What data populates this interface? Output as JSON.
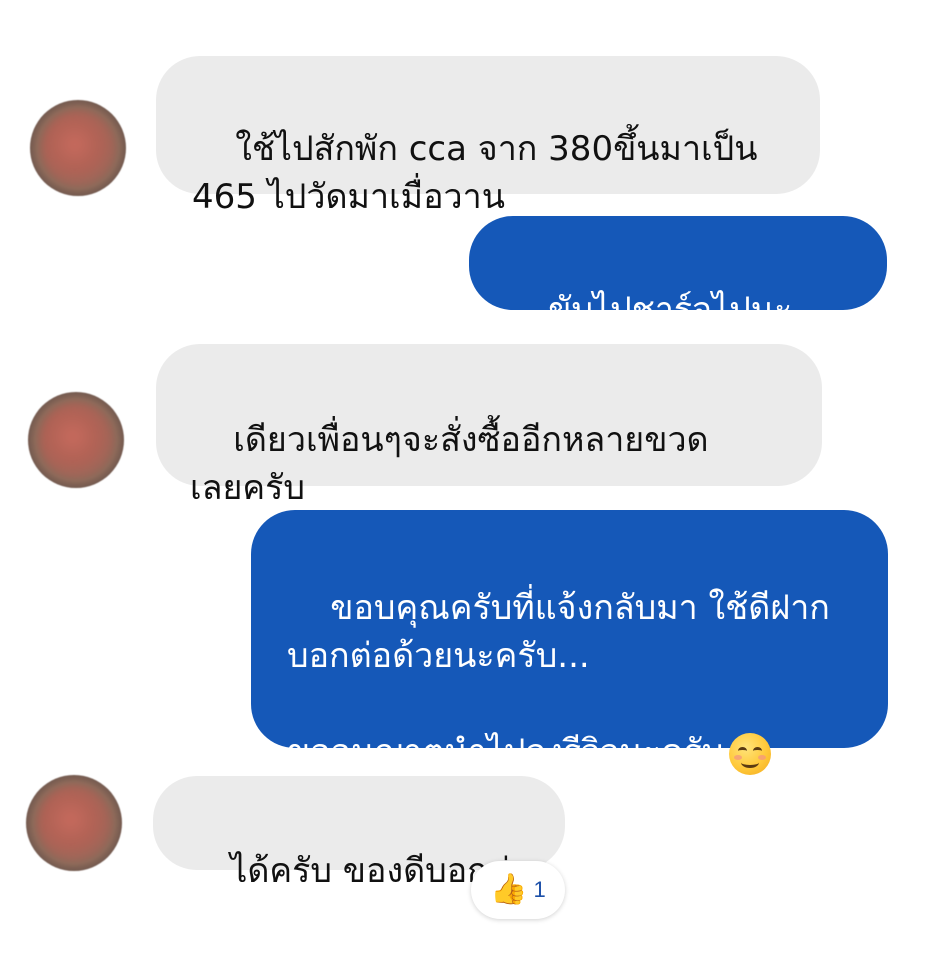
{
  "messages": [
    {
      "direction": "incoming",
      "text": "ใช้ไปสักพัก cca จาก 380ขึ้นมาเป็น\n465 ไปวัดมาเมื่อวาน"
    },
    {
      "direction": "outgoing",
      "text": "ขับไปชาร์จไปนะครับ"
    },
    {
      "direction": "incoming",
      "text": "เดียวเพื่อนๆจะสั่งซื้ออีกหลายขวด\nเลยครับ"
    },
    {
      "direction": "outgoing",
      "text": "ขอบคุณครับที่แจ้งกลับมา ใช้ดีฝาก\nบอกต่อด้วยนะครับ...\n\nขออนุญาตนำไปลงรีวิวนะครับ",
      "emoji": "smiling-face-emoji"
    },
    {
      "direction": "incoming",
      "text": "ได้ครับ ของดีบอกต่อ"
    }
  ],
  "reaction": {
    "icon": "thumbs-up-icon",
    "count": "1"
  },
  "colors": {
    "incoming_bg": "#ebebeb",
    "outgoing_bg": "#1558b8",
    "outgoing_text": "#ffffff",
    "reaction_count": "#1b4fa8"
  }
}
